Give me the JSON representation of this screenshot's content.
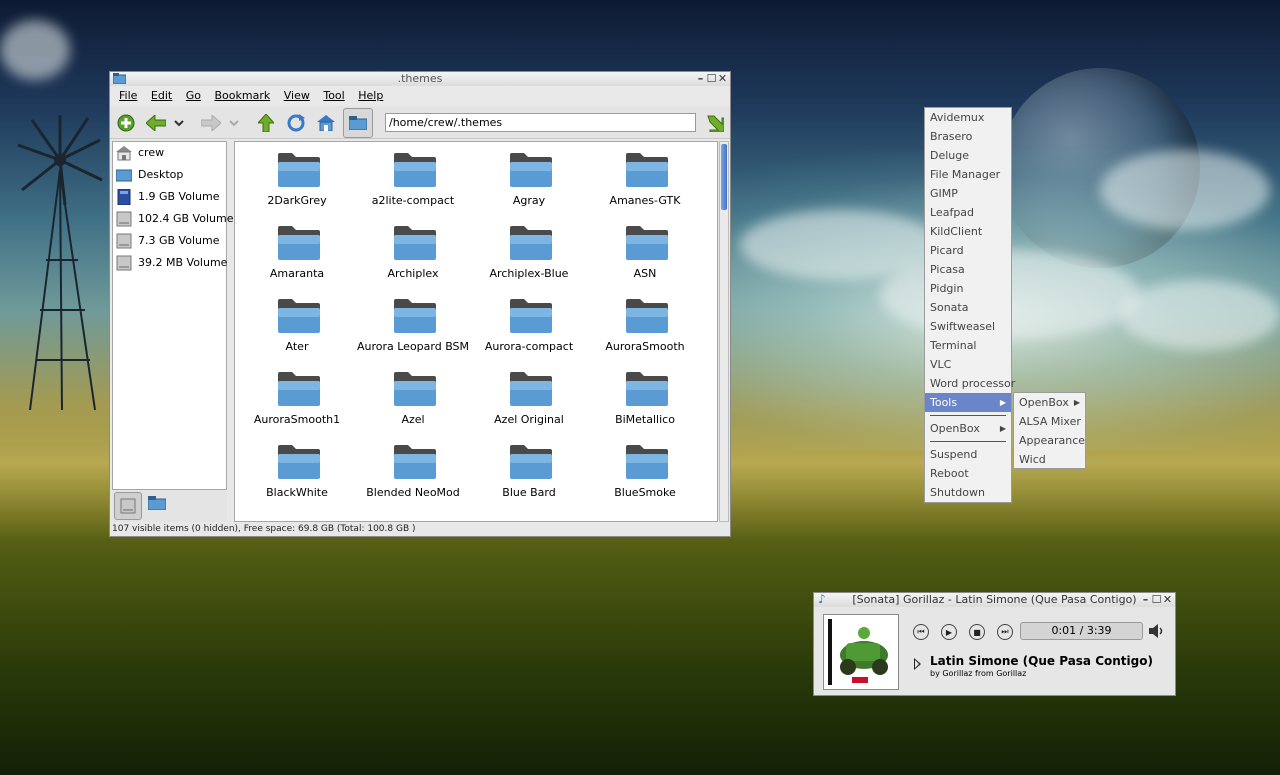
{
  "file_manager": {
    "title": ".themes",
    "menu": [
      "File",
      "Edit",
      "Go",
      "Bookmark",
      "View",
      "Tool",
      "Help"
    ],
    "path": "/home/crew/.themes",
    "side_pane": [
      "crew",
      "Desktop",
      "1.9 GB Volume",
      "102.4 GB Volume",
      "7.3 GB Volume",
      "39.2 MB Volume"
    ],
    "folders": [
      "2DarkGrey",
      "a2lite-compact",
      "Agray",
      "Amanes-GTK",
      "Amaranta",
      "Archiplex",
      "Archiplex-Blue",
      "ASN",
      "Ater",
      "Aurora Leopard BSM",
      "Aurora-compact",
      "AuroraSmooth",
      "AuroraSmooth1",
      "Azel",
      "Azel Original",
      "BiMetallico",
      "BlackWhite",
      "Blended NeoMod",
      "Blue Bard",
      "BlueSmoke"
    ],
    "status": "107 visible items (0 hidden), Free space: 69.8 GB (Total: 100.8 GB )",
    "accent_color": "#5a9bd3"
  },
  "root_menu": {
    "items": [
      {
        "label": "Avidemux"
      },
      {
        "label": "Brasero"
      },
      {
        "label": "Deluge"
      },
      {
        "label": "File Manager"
      },
      {
        "label": "GIMP"
      },
      {
        "label": "Leafpad"
      },
      {
        "label": "KildClient"
      },
      {
        "label": "Picard"
      },
      {
        "label": "Picasa"
      },
      {
        "label": "Pidgin"
      },
      {
        "label": "Sonata"
      },
      {
        "label": "Swiftweasel"
      },
      {
        "label": "Terminal"
      },
      {
        "label": "VLC"
      },
      {
        "label": "Word processor"
      },
      {
        "label": "Tools",
        "submenu": true,
        "selected": true
      },
      {
        "separator": true
      },
      {
        "label": "OpenBox",
        "submenu": true
      },
      {
        "separator": true
      },
      {
        "label": "Suspend"
      },
      {
        "label": "Reboot"
      },
      {
        "label": "Shutdown"
      }
    ],
    "selected_color": "#6a86c8"
  },
  "tools_submenu": {
    "items": [
      {
        "label": "OpenBox",
        "submenu": true
      },
      {
        "label": "ALSA Mixer"
      },
      {
        "label": "Appearance"
      },
      {
        "label": "Wicd"
      }
    ]
  },
  "sonata": {
    "title": "[Sonata] Gorillaz - Latin Simone (Que Pasa Contigo)",
    "time": "0:01 / 3:39",
    "song_title": "Latin Simone (Que Pasa Contigo)",
    "song_sub": "by Gorillaz from Gorillaz"
  }
}
